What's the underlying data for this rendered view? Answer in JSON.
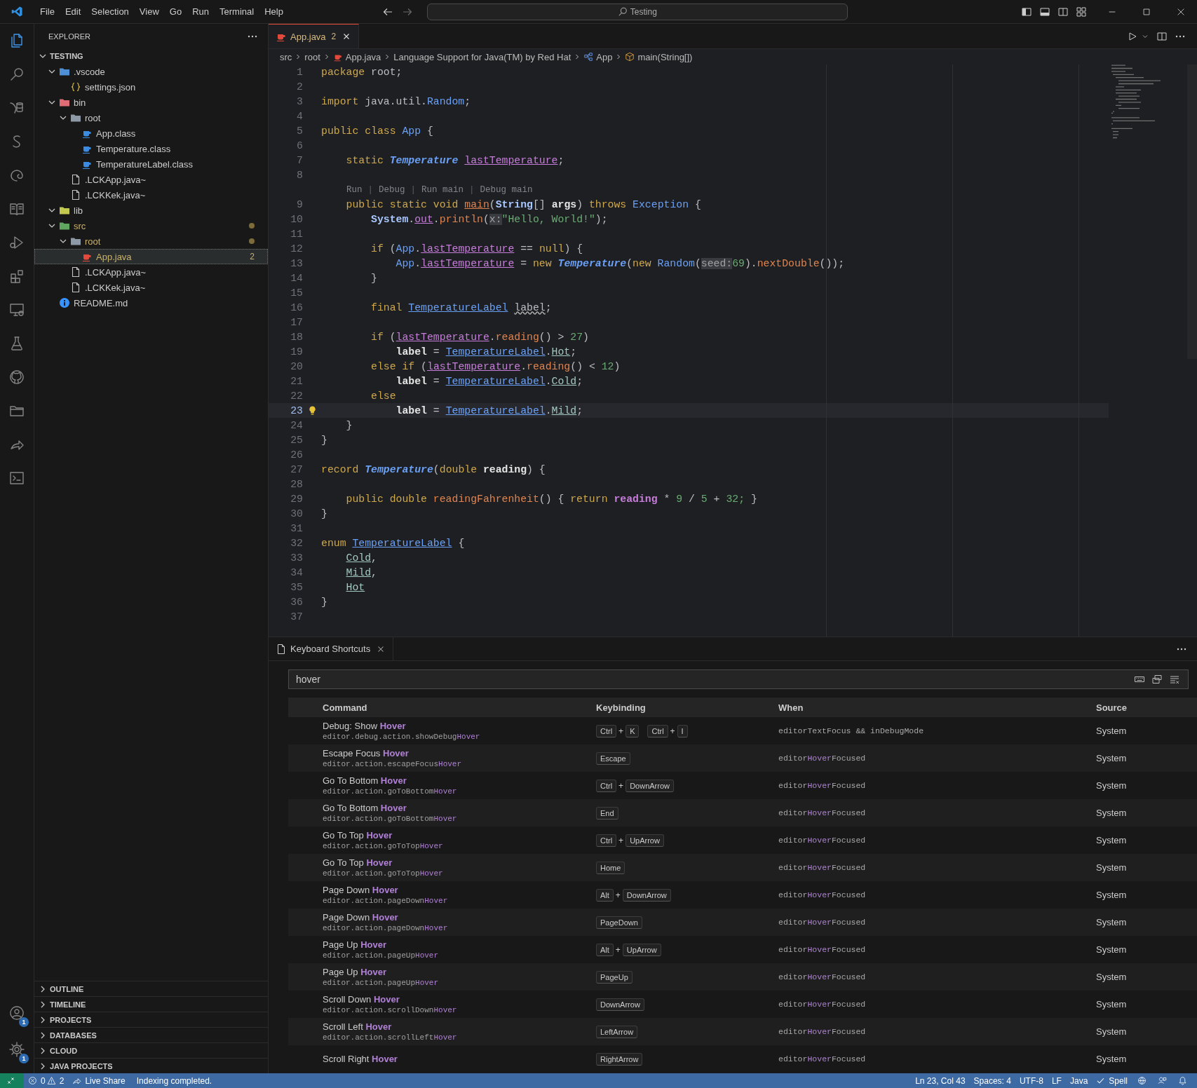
{
  "title_bar": {
    "menu": [
      "File",
      "Edit",
      "Selection",
      "View",
      "Go",
      "Run",
      "Terminal",
      "Help"
    ],
    "command_center": "Testing"
  },
  "activity_bar": {
    "items": [
      {
        "kind": "explorer",
        "selected": true
      },
      {
        "kind": "search",
        "selected": false
      },
      {
        "kind": "database",
        "selected": false
      },
      {
        "kind": "s-logo",
        "selected": false
      },
      {
        "kind": "swirl",
        "selected": false
      },
      {
        "kind": "book",
        "selected": false
      },
      {
        "kind": "run-debug",
        "selected": false
      },
      {
        "kind": "extensions",
        "selected": false
      },
      {
        "kind": "remote",
        "selected": false
      },
      {
        "kind": "flask",
        "selected": false
      },
      {
        "kind": "cat",
        "selected": false
      },
      {
        "kind": "folder",
        "selected": false
      },
      {
        "kind": "share",
        "selected": false
      },
      {
        "kind": "terminal",
        "selected": false
      }
    ],
    "account_badge": "1",
    "manage_badge": "1"
  },
  "sidebar": {
    "title": "EXPLORER",
    "workspace": {
      "label": "TESTING",
      "expanded": true
    },
    "tree": [
      {
        "name": ".vscode",
        "kind": "folder-vscode",
        "expanded": true,
        "selected": false,
        "modified": false,
        "children": [
          {
            "name": "settings.json",
            "kind": "json",
            "selected": false,
            "modified": false
          }
        ]
      },
      {
        "name": "bin",
        "kind": "folder-bin",
        "expanded": true,
        "selected": false,
        "modified": false,
        "children": [
          {
            "name": "root",
            "kind": "folder",
            "expanded": true,
            "selected": false,
            "modified": false,
            "children": [
              {
                "name": "App.class",
                "kind": "class",
                "selected": false,
                "modified": false
              },
              {
                "name": "Temperature.class",
                "kind": "class",
                "selected": false,
                "modified": false
              },
              {
                "name": "TemperatureLabel.class",
                "kind": "class",
                "selected": false,
                "modified": false
              }
            ]
          },
          {
            "name": ".LCKApp.java~",
            "kind": "file",
            "selected": false,
            "modified": false
          },
          {
            "name": ".LCKKek.java~",
            "kind": "file",
            "selected": false,
            "modified": false
          }
        ]
      },
      {
        "name": "lib",
        "kind": "folder-lib",
        "expanded": true,
        "selected": false,
        "modified": false
      },
      {
        "name": "src",
        "kind": "folder-src",
        "expanded": true,
        "selected": false,
        "modified": true,
        "children": [
          {
            "name": "root",
            "kind": "folder",
            "expanded": true,
            "selected": false,
            "modified": true,
            "children": [
              {
                "name": "App.java",
                "kind": "java",
                "selected": true,
                "modified": true,
                "badge": "2"
              }
            ]
          },
          {
            "name": ".LCKApp.java~",
            "kind": "file",
            "selected": false,
            "modified": false
          },
          {
            "name": ".LCKKek.java~",
            "kind": "file",
            "selected": false,
            "modified": false
          }
        ]
      },
      {
        "name": "README.md",
        "kind": "info",
        "selected": false,
        "modified": false
      }
    ],
    "sections": [
      {
        "label": "OUTLINE",
        "expanded": false
      },
      {
        "label": "TIMELINE",
        "expanded": false
      },
      {
        "label": "PROJECTS",
        "expanded": false
      },
      {
        "label": "DATABASES",
        "expanded": false
      },
      {
        "label": "CLOUD",
        "expanded": false
      },
      {
        "label": "JAVA PROJECTS",
        "expanded": false
      }
    ]
  },
  "editor": {
    "tabs": [
      {
        "label": "App.java",
        "badge": "2",
        "selected": true
      }
    ],
    "breadcrumbs": [
      {
        "kind": "folder",
        "text": "src"
      },
      {
        "kind": "folder",
        "text": "root"
      },
      {
        "kind": "java",
        "text": "App.java"
      },
      {
        "kind": "plain",
        "text": "Language Support for Java(TM) by Red Hat"
      },
      {
        "kind": "class",
        "text": "App"
      },
      {
        "kind": "method",
        "text": "main(String[])"
      }
    ],
    "lines": [
      {
        "kind": "code",
        "number": "1",
        "current": false,
        "tokens": [
          {
            "kind": "kw",
            "text": "package"
          },
          {
            "kind": "plain",
            "text": " root;"
          }
        ]
      },
      {
        "kind": "code",
        "number": "2",
        "current": false
      },
      {
        "kind": "code",
        "number": "3",
        "current": false,
        "tokens": [
          {
            "kind": "kw",
            "text": "import"
          },
          {
            "kind": "plain",
            "text": " java.util."
          },
          {
            "kind": "type",
            "text": "Random"
          },
          {
            "kind": "plain",
            "text": ";"
          }
        ]
      },
      {
        "kind": "code",
        "number": "4",
        "current": false
      },
      {
        "kind": "code",
        "number": "5",
        "current": false,
        "tokens": [
          {
            "kind": "kw",
            "text": "public class "
          },
          {
            "kind": "type",
            "text": "App"
          },
          {
            "kind": "plain",
            "text": " {"
          }
        ]
      },
      {
        "kind": "code",
        "number": "6",
        "current": false
      },
      {
        "kind": "code",
        "number": "7",
        "current": false,
        "tokens": [
          {
            "kind": "kw",
            "text": "    static "
          },
          {
            "kind": "type-em",
            "text": "Temperature "
          },
          {
            "kind": "field",
            "text": "lastTemperature"
          },
          {
            "kind": "plain",
            "text": ";"
          }
        ]
      },
      {
        "kind": "code",
        "number": "8",
        "current": false
      },
      {
        "kind": "codelens",
        "actions": [
          {
            "kind": "link",
            "text": "Run"
          },
          {
            "kind": "sep",
            "text": "|"
          },
          {
            "kind": "link",
            "text": "Debug"
          },
          {
            "kind": "sep",
            "text": "|"
          },
          {
            "kind": "link",
            "text": "Run main"
          },
          {
            "kind": "sep",
            "text": "|"
          },
          {
            "kind": "link",
            "text": "Debug main"
          }
        ]
      },
      {
        "kind": "code",
        "number": "9",
        "current": false,
        "tokens": [
          {
            "kind": "kw",
            "text": "    public static void "
          },
          {
            "kind": "method-decl",
            "text": "main"
          },
          {
            "kind": "plain",
            "text": "("
          },
          {
            "kind": "type-bold",
            "text": "String"
          },
          {
            "kind": "plain",
            "text": "[] "
          },
          {
            "kind": "param",
            "text": "args"
          },
          {
            "kind": "plain",
            "text": ") "
          },
          {
            "kind": "kw",
            "text": "throws "
          },
          {
            "kind": "type",
            "text": "Exception"
          },
          {
            "kind": "plain",
            "text": " {"
          }
        ]
      },
      {
        "kind": "code",
        "number": "10",
        "current": false,
        "tokens": [
          {
            "kind": "type-bold",
            "text": "        System"
          },
          {
            "kind": "plain",
            "text": "."
          },
          {
            "kind": "field",
            "text": "out"
          },
          {
            "kind": "plain",
            "text": "."
          },
          {
            "kind": "method",
            "text": "println"
          },
          {
            "kind": "plain",
            "text": "("
          },
          {
            "kind": "hint",
            "text": "x:"
          },
          {
            "kind": "str",
            "text": "\"Hello, World!\""
          },
          {
            "kind": "plain",
            "text": ");"
          }
        ]
      },
      {
        "kind": "code",
        "number": "11",
        "current": false
      },
      {
        "kind": "code",
        "number": "12",
        "current": false,
        "tokens": [
          {
            "kind": "kw",
            "text": "        if"
          },
          {
            "kind": "plain",
            "text": " ("
          },
          {
            "kind": "type",
            "text": "App"
          },
          {
            "kind": "plain",
            "text": "."
          },
          {
            "kind": "field",
            "text": "lastTemperature"
          },
          {
            "kind": "plain",
            "text": " == "
          },
          {
            "kind": "kw",
            "text": "null"
          },
          {
            "kind": "plain",
            "text": ") {"
          }
        ]
      },
      {
        "kind": "code",
        "number": "13",
        "current": false,
        "tokens": [
          {
            "kind": "type",
            "text": "            App"
          },
          {
            "kind": "plain",
            "text": "."
          },
          {
            "kind": "field",
            "text": "lastTemperature"
          },
          {
            "kind": "plain",
            "text": " = "
          },
          {
            "kind": "kw",
            "text": "new "
          },
          {
            "kind": "type-em",
            "text": "Temperature"
          },
          {
            "kind": "plain",
            "text": "("
          },
          {
            "kind": "kw",
            "text": "new "
          },
          {
            "kind": "type",
            "text": "Random"
          },
          {
            "kind": "plain",
            "text": "("
          },
          {
            "kind": "hint",
            "text": "seed:"
          },
          {
            "kind": "num",
            "text": "69"
          },
          {
            "kind": "plain",
            "text": ")."
          },
          {
            "kind": "method",
            "text": "nextDouble"
          },
          {
            "kind": "plain",
            "text": "());"
          }
        ]
      },
      {
        "kind": "code",
        "number": "14",
        "current": false,
        "tokens": [
          {
            "kind": "plain",
            "text": "        }"
          }
        ]
      },
      {
        "kind": "code",
        "number": "15",
        "current": false
      },
      {
        "kind": "code",
        "number": "16",
        "current": false,
        "tokens": [
          {
            "kind": "kw",
            "text": "        final "
          },
          {
            "kind": "ref",
            "text": "TemperatureLabel"
          },
          {
            "kind": "warn",
            "text": " label"
          },
          {
            "kind": "plain",
            "text": ";"
          }
        ]
      },
      {
        "kind": "code",
        "number": "17",
        "current": false
      },
      {
        "kind": "code",
        "number": "18",
        "current": false,
        "tokens": [
          {
            "kind": "kw",
            "text": "        if"
          },
          {
            "kind": "plain",
            "text": " ("
          },
          {
            "kind": "field",
            "text": "lastTemperature"
          },
          {
            "kind": "plain",
            "text": "."
          },
          {
            "kind": "method",
            "text": "reading"
          },
          {
            "kind": "plain",
            "text": "() > "
          },
          {
            "kind": "num",
            "text": "27"
          },
          {
            "kind": "plain",
            "text": ")"
          }
        ]
      },
      {
        "kind": "code",
        "number": "19",
        "current": false,
        "tokens": [
          {
            "kind": "param",
            "text": "            label"
          },
          {
            "kind": "plain",
            "text": " = "
          },
          {
            "kind": "ref",
            "text": "TemperatureLabel"
          },
          {
            "kind": "plain",
            "text": "."
          },
          {
            "kind": "const",
            "text": "Hot"
          },
          {
            "kind": "plain",
            "text": ";"
          }
        ]
      },
      {
        "kind": "code",
        "number": "20",
        "current": false,
        "tokens": [
          {
            "kind": "kw",
            "text": "        else if"
          },
          {
            "kind": "plain",
            "text": " ("
          },
          {
            "kind": "field",
            "text": "lastTemperature"
          },
          {
            "kind": "plain",
            "text": "."
          },
          {
            "kind": "method",
            "text": "reading"
          },
          {
            "kind": "plain",
            "text": "() < "
          },
          {
            "kind": "num",
            "text": "12"
          },
          {
            "kind": "plain",
            "text": ")"
          }
        ]
      },
      {
        "kind": "code",
        "number": "21",
        "current": false,
        "tokens": [
          {
            "kind": "param",
            "text": "            label"
          },
          {
            "kind": "plain",
            "text": " = "
          },
          {
            "kind": "ref",
            "text": "TemperatureLabel"
          },
          {
            "kind": "plain",
            "text": "."
          },
          {
            "kind": "const",
            "text": "Cold"
          },
          {
            "kind": "plain",
            "text": ";"
          }
        ]
      },
      {
        "kind": "code",
        "number": "22",
        "current": false,
        "tokens": [
          {
            "kind": "kw",
            "text": "        else"
          }
        ]
      },
      {
        "kind": "code",
        "number": "23",
        "current": true,
        "tokens": [
          {
            "kind": "param",
            "text": "            label"
          },
          {
            "kind": "plain",
            "text": " = "
          },
          {
            "kind": "ref",
            "text": "TemperatureLabel"
          },
          {
            "kind": "plain",
            "text": "."
          },
          {
            "kind": "const",
            "text": "Mild"
          },
          {
            "kind": "plain",
            "text": ";"
          }
        ]
      },
      {
        "kind": "code",
        "number": "24",
        "current": false,
        "tokens": [
          {
            "kind": "plain",
            "text": "    }"
          }
        ]
      },
      {
        "kind": "code",
        "number": "25",
        "current": false,
        "tokens": [
          {
            "kind": "plain",
            "text": "}"
          }
        ]
      },
      {
        "kind": "code",
        "number": "26",
        "current": false
      },
      {
        "kind": "code",
        "number": "27",
        "current": false,
        "tokens": [
          {
            "kind": "kw",
            "text": "record "
          },
          {
            "kind": "type-em",
            "text": "Temperature"
          },
          {
            "kind": "plain",
            "text": "("
          },
          {
            "kind": "kw",
            "text": "double "
          },
          {
            "kind": "param",
            "text": "reading"
          },
          {
            "kind": "plain",
            "text": ") {"
          }
        ]
      },
      {
        "kind": "code",
        "number": "28",
        "current": false
      },
      {
        "kind": "code",
        "number": "29",
        "current": false,
        "tokens": [
          {
            "kind": "kw",
            "text": "    public double "
          },
          {
            "kind": "method",
            "text": "readingFahrenheit"
          },
          {
            "kind": "plain",
            "text": "() { "
          },
          {
            "kind": "kw",
            "text": "return "
          },
          {
            "kind": "field-bold",
            "text": "reading"
          },
          {
            "kind": "plain",
            "text": " * "
          },
          {
            "kind": "num",
            "text": "9"
          },
          {
            "kind": "plain",
            "text": " / "
          },
          {
            "kind": "num",
            "text": "5"
          },
          {
            "kind": "plain",
            "text": " + "
          },
          {
            "kind": "num",
            "text": "32;"
          },
          {
            "kind": "plain",
            "text": " }"
          }
        ]
      },
      {
        "kind": "code",
        "number": "30",
        "current": false,
        "tokens": [
          {
            "kind": "plain",
            "text": "}"
          }
        ]
      },
      {
        "kind": "code",
        "number": "31",
        "current": false
      },
      {
        "kind": "code",
        "number": "32",
        "current": false,
        "tokens": [
          {
            "kind": "kw",
            "text": "enum "
          },
          {
            "kind": "ref",
            "text": "TemperatureLabel"
          },
          {
            "kind": "plain",
            "text": " {"
          }
        ]
      },
      {
        "kind": "code",
        "number": "33",
        "current": false,
        "tokens": [
          {
            "kind": "const",
            "text": "    Cold"
          },
          {
            "kind": "plain",
            "text": ","
          }
        ]
      },
      {
        "kind": "code",
        "number": "34",
        "current": false,
        "tokens": [
          {
            "kind": "const",
            "text": "    Mild"
          },
          {
            "kind": "plain",
            "text": ","
          }
        ]
      },
      {
        "kind": "code",
        "number": "35",
        "current": false,
        "tokens": [
          {
            "kind": "const",
            "text": "    Hot"
          }
        ]
      },
      {
        "kind": "code",
        "number": "36",
        "current": false,
        "tokens": [
          {
            "kind": "plain",
            "text": "}"
          }
        ]
      },
      {
        "kind": "code",
        "number": "37",
        "current": false
      }
    ]
  },
  "panel": {
    "tabs": [
      {
        "label": "Keyboard Shortcuts",
        "selected": true
      }
    ],
    "search": {
      "value": "hover"
    },
    "columns": [
      "Command",
      "Keybinding",
      "When",
      "Source"
    ],
    "rows": [
      {
        "command": "Debug: Show **Hover**",
        "id": "editor.debug.action.showDebug**Hover**",
        "keys": [
          {
            "kind": "key",
            "text": "Ctrl"
          },
          {
            "kind": "plus",
            "text": "+"
          },
          {
            "kind": "key",
            "text": "K"
          },
          {
            "kind": "gap"
          },
          {
            "kind": "key",
            "text": "Ctrl"
          },
          {
            "kind": "plus",
            "text": "+"
          },
          {
            "kind": "key",
            "text": "I"
          }
        ],
        "when": "editorTextFocus && inDebugMode",
        "source": "System"
      },
      {
        "command": "Escape Focus **Hover**",
        "id": "editor.action.escapeFocus**Hover**",
        "keys": [
          {
            "kind": "key",
            "text": "Escape"
          }
        ],
        "when": "editor**Hover**Focused",
        "source": "System"
      },
      {
        "command": "Go To Bottom **Hover**",
        "id": "editor.action.goToBottom**Hover**",
        "keys": [
          {
            "kind": "key",
            "text": "Ctrl"
          },
          {
            "kind": "plus",
            "text": "+"
          },
          {
            "kind": "key",
            "text": "DownArrow"
          }
        ],
        "when": "editor**Hover**Focused",
        "source": "System"
      },
      {
        "command": "Go To Bottom **Hover**",
        "id": "editor.action.goToBottom**Hover**",
        "keys": [
          {
            "kind": "key",
            "text": "End"
          }
        ],
        "when": "editor**Hover**Focused",
        "source": "System"
      },
      {
        "command": "Go To Top **Hover**",
        "id": "editor.action.goToTop**Hover**",
        "keys": [
          {
            "kind": "key",
            "text": "Ctrl"
          },
          {
            "kind": "plus",
            "text": "+"
          },
          {
            "kind": "key",
            "text": "UpArrow"
          }
        ],
        "when": "editor**Hover**Focused",
        "source": "System"
      },
      {
        "command": "Go To Top **Hover**",
        "id": "editor.action.goToTop**Hover**",
        "keys": [
          {
            "kind": "key",
            "text": "Home"
          }
        ],
        "when": "editor**Hover**Focused",
        "source": "System"
      },
      {
        "command": "Page Down **Hover**",
        "id": "editor.action.pageDown**Hover**",
        "keys": [
          {
            "kind": "key",
            "text": "Alt"
          },
          {
            "kind": "plus",
            "text": "+"
          },
          {
            "kind": "key",
            "text": "DownArrow"
          }
        ],
        "when": "editor**Hover**Focused",
        "source": "System"
      },
      {
        "command": "Page Down **Hover**",
        "id": "editor.action.pageDown**Hover**",
        "keys": [
          {
            "kind": "key",
            "text": "PageDown"
          }
        ],
        "when": "editor**Hover**Focused",
        "source": "System"
      },
      {
        "command": "Page Up **Hover**",
        "id": "editor.action.pageUp**Hover**",
        "keys": [
          {
            "kind": "key",
            "text": "Alt"
          },
          {
            "kind": "plus",
            "text": "+"
          },
          {
            "kind": "key",
            "text": "UpArrow"
          }
        ],
        "when": "editor**Hover**Focused",
        "source": "System"
      },
      {
        "command": "Page Up **Hover**",
        "id": "editor.action.pageUp**Hover**",
        "keys": [
          {
            "kind": "key",
            "text": "PageUp"
          }
        ],
        "when": "editor**Hover**Focused",
        "source": "System"
      },
      {
        "command": "Scroll Down **Hover**",
        "id": "editor.action.scrollDown**Hover**",
        "keys": [
          {
            "kind": "key",
            "text": "DownArrow"
          }
        ],
        "when": "editor**Hover**Focused",
        "source": "System"
      },
      {
        "command": "Scroll Left **Hover**",
        "id": "editor.action.scrollLeft**Hover**",
        "keys": [
          {
            "kind": "key",
            "text": "LeftArrow"
          }
        ],
        "when": "editor**Hover**Focused",
        "source": "System"
      },
      {
        "command": "Scroll Right **Hover**",
        "keys": [
          {
            "kind": "key",
            "text": "RightArrow"
          }
        ],
        "when": "editor**Hover**Focused",
        "source": "System"
      }
    ]
  },
  "status_bar": {
    "errors": "0",
    "warnings": "2",
    "live_share": "Live Share",
    "message": "Indexing completed.",
    "items": [
      "Ln 23, Col 43",
      "Spaces: 4",
      "UTF-8",
      "LF",
      "Java"
    ],
    "spell": "Spell"
  }
}
